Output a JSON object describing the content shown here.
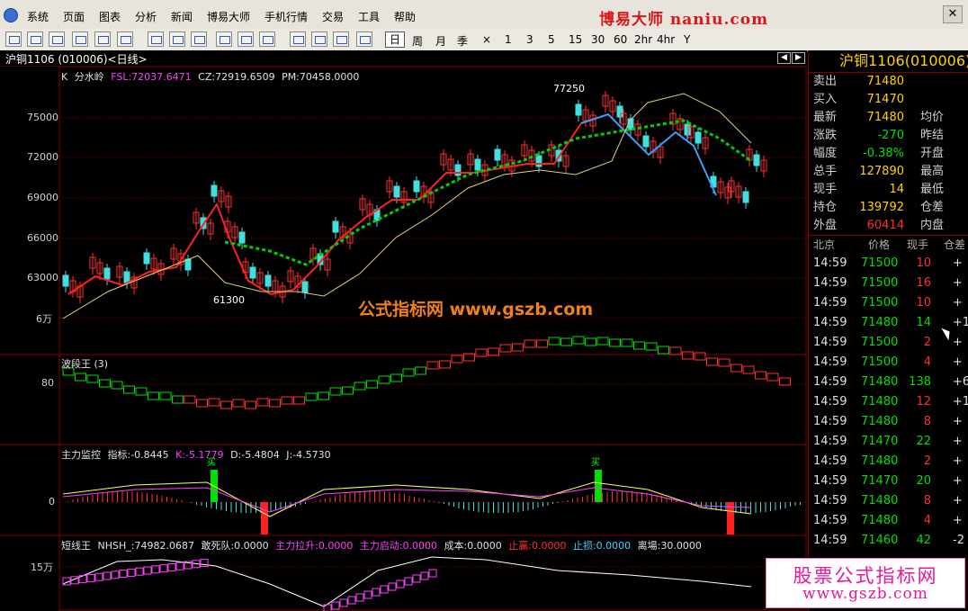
{
  "menu": [
    "系统",
    "页面",
    "图表",
    "分析",
    "新闻",
    "博易大师",
    "手机行情",
    "交易",
    "工具",
    "帮助"
  ],
  "brand": "博易大师 naniu.com",
  "periods": [
    "日",
    "周",
    "月",
    "季",
    "×",
    "1",
    "3",
    "5",
    "15",
    "30",
    "60",
    "2hr",
    "4hr",
    "Y"
  ],
  "chart_title": "沪铜1106 (010006)<日线>",
  "price_axis": [
    "75000",
    "72000",
    "69000",
    "66000",
    "63000",
    "6万"
  ],
  "k_legend": {
    "k": "K",
    "name": "分水岭",
    "fsl": "FSL:72037.6471",
    "cz": "CZ:72919.6509",
    "pm": "PM:70458.0000"
  },
  "annotations": {
    "high": "77250",
    "low": "61300"
  },
  "wave_panel": {
    "title": "波段王 (3)",
    "axis": "80"
  },
  "main_panel": {
    "title": "主力监控",
    "idx": "指标:-0.8445",
    "k": "K:-5.1779",
    "d": "D:-5.4804",
    "j": "J:-4.5730",
    "axis": "0",
    "marker": "买"
  },
  "short_panel": {
    "name": "短线王",
    "nhsh": "NHSH_:74982.0687",
    "gsd": "敢死队:0.0000",
    "zlls": "主力拉升:0.0000",
    "zlqd": "主力启动:0.0000",
    "cb": "成本:0.0000",
    "zy": "止赢:0.0000",
    "zs": "止损:0.0000",
    "lc": "离場:30.0000",
    "axis": "15万"
  },
  "quote": {
    "title": "沪铜1106(010006)",
    "rows": [
      {
        "k": "卖出",
        "v": "71480",
        "c": "#ffd200",
        "k2": ""
      },
      {
        "k": "买入",
        "v": "71470",
        "c": "#ffd200",
        "k2": ""
      },
      {
        "k": "最新",
        "v": "71480",
        "c": "#ffd200",
        "k2": "均价"
      },
      {
        "k": "涨跌",
        "v": "-270",
        "c": "#00e000",
        "k2": "昨结"
      },
      {
        "k": "幅度",
        "v": "-0.38%",
        "c": "#00e000",
        "k2": "开盘"
      },
      {
        "k": "总手",
        "v": "127890",
        "c": "#ffd200",
        "k2": "最高"
      },
      {
        "k": "现手",
        "v": "14",
        "c": "#ffd200",
        "k2": "最低"
      },
      {
        "k": "持仓",
        "v": "139792",
        "c": "#ffd200",
        "k2": "仓差"
      },
      {
        "k": "外盘",
        "v": "60414",
        "c": "#ff3030",
        "k2": "内盘"
      }
    ],
    "tick_head": [
      "北京",
      "价格",
      "现手",
      "仓差"
    ],
    "ticks": [
      {
        "t": "14:59",
        "p": "71500",
        "q": "10",
        "qc": "#ff3030",
        "d": "+"
      },
      {
        "t": "14:59",
        "p": "71500",
        "q": "16",
        "qc": "#ff3030",
        "d": "+"
      },
      {
        "t": "14:59",
        "p": "71500",
        "q": "10",
        "qc": "#ff3030",
        "d": "+"
      },
      {
        "t": "14:59",
        "p": "71480",
        "q": "14",
        "qc": "#00e000",
        "d": "+1"
      },
      {
        "t": "14:59",
        "p": "71500",
        "q": "2",
        "qc": "#ff3030",
        "d": "+"
      },
      {
        "t": "14:59",
        "p": "71500",
        "q": "4",
        "qc": "#ff3030",
        "d": "+"
      },
      {
        "t": "14:59",
        "p": "71480",
        "q": "138",
        "qc": "#00e000",
        "d": "+6"
      },
      {
        "t": "14:59",
        "p": "71480",
        "q": "12",
        "qc": "#ff3030",
        "d": "+1"
      },
      {
        "t": "14:59",
        "p": "71480",
        "q": "8",
        "qc": "#ff3030",
        "d": "+"
      },
      {
        "t": "14:59",
        "p": "71470",
        "q": "22",
        "qc": "#00e000",
        "d": "+"
      },
      {
        "t": "14:59",
        "p": "71480",
        "q": "2",
        "qc": "#ff3030",
        "d": "+"
      },
      {
        "t": "14:59",
        "p": "71470",
        "q": "20",
        "qc": "#00e000",
        "d": "+"
      },
      {
        "t": "14:59",
        "p": "71480",
        "q": "8",
        "qc": "#ff3030",
        "d": "+"
      },
      {
        "t": "14:59",
        "p": "71480",
        "q": "4",
        "qc": "#ff3030",
        "d": "+"
      },
      {
        "t": "14:59",
        "p": "71460",
        "q": "42",
        "qc": "#00e000",
        "d": "-2"
      }
    ]
  },
  "watermark": "公式指标网 www.gszb.com",
  "ad": {
    "l1": "股票公式指标网",
    "l2": "www.gszb.com"
  },
  "colors": {
    "up": "#ff3030",
    "down": "#00e000",
    "text": "#ffd200",
    "grid": "#800000"
  }
}
